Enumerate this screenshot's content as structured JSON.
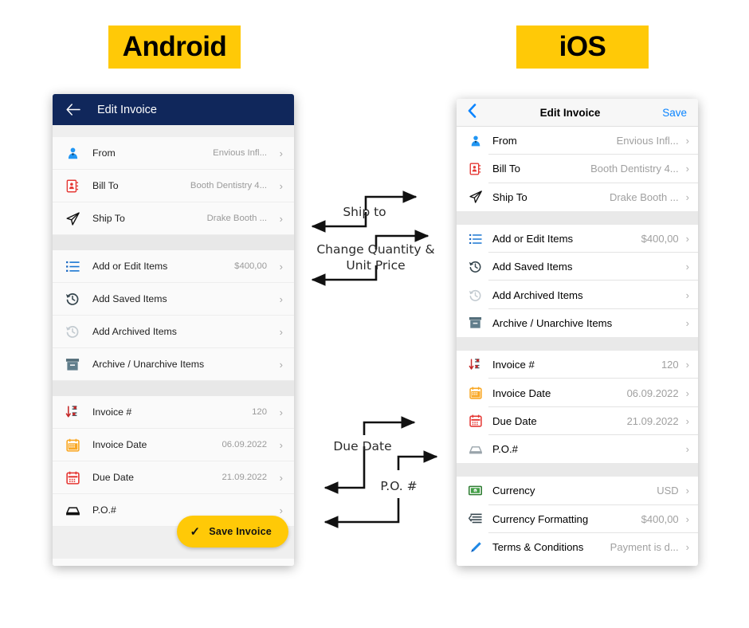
{
  "badges": {
    "android": "Android",
    "ios": "iOS"
  },
  "colors": {
    "brand_yellow": "#FFC907",
    "android_header_navy": "#10275B",
    "ios_accent_blue": "#0A84FF",
    "value_gray": "#9A9A9A"
  },
  "android": {
    "header": {
      "back_icon": "arrow-left-icon",
      "title": "Edit Invoice"
    },
    "sections": [
      {
        "rows": [
          {
            "icon": "person-blue-icon",
            "label": "From",
            "value": "Envious Infl...",
            "chevron": "›"
          },
          {
            "icon": "contact-card-icon",
            "label": "Bill To",
            "value": "Booth Dentistry 4...",
            "chevron": "›"
          },
          {
            "icon": "paper-plane-icon",
            "label": "Ship To",
            "value": "Drake Booth ...",
            "chevron": "›"
          }
        ]
      },
      {
        "rows": [
          {
            "icon": "list-icon",
            "label": "Add or Edit Items",
            "value": "$400,00",
            "chevron": "›"
          },
          {
            "icon": "history-icon",
            "label": "Add Saved Items",
            "value": "",
            "chevron": "›"
          },
          {
            "icon": "history-dim-icon",
            "label": "Add Archived Items",
            "value": "",
            "chevron": "›"
          },
          {
            "icon": "archive-box-icon",
            "label": "Archive / Unarchive Items",
            "value": "",
            "chevron": "›"
          }
        ]
      },
      {
        "rows": [
          {
            "icon": "sort-numeric-icon",
            "label": "Invoice #",
            "value": "120",
            "chevron": "›"
          },
          {
            "icon": "calendar-orange-icon",
            "label": "Invoice Date",
            "value": "06.09.2022",
            "chevron": "›"
          },
          {
            "icon": "calendar-red-icon",
            "label": "Due Date",
            "value": "21.09.2022",
            "chevron": "›"
          },
          {
            "icon": "inbox-icon",
            "label": "P.O.#",
            "value": "",
            "chevron": "›"
          }
        ]
      }
    ],
    "save_button": {
      "icon": "check-icon",
      "label": "Save Invoice"
    }
  },
  "ios": {
    "header": {
      "back_icon": "chevron-left-icon",
      "title": "Edit Invoice",
      "save_label": "Save"
    },
    "sections": [
      {
        "rows": [
          {
            "icon": "person-blue-icon",
            "label": "From",
            "value": "Envious Infl...",
            "chevron": "›"
          },
          {
            "icon": "contact-card-icon",
            "label": "Bill To",
            "value": "Booth Dentistry 4...",
            "chevron": "›"
          },
          {
            "icon": "paper-plane-icon",
            "label": "Ship To",
            "value": "Drake Booth ...",
            "chevron": "›"
          }
        ]
      },
      {
        "rows": [
          {
            "icon": "list-icon",
            "label": "Add or Edit Items",
            "value": "$400,00",
            "chevron": "›"
          },
          {
            "icon": "history-icon",
            "label": "Add Saved Items",
            "value": "",
            "chevron": "›"
          },
          {
            "icon": "history-dim-icon",
            "label": "Add Archived Items",
            "value": "",
            "chevron": "›"
          },
          {
            "icon": "archive-box-icon",
            "label": "Archive / Unarchive Items",
            "value": "",
            "chevron": "›"
          }
        ]
      },
      {
        "rows": [
          {
            "icon": "sort-numeric-icon",
            "label": "Invoice #",
            "value": "120",
            "chevron": "›"
          },
          {
            "icon": "calendar-orange-icon",
            "label": "Invoice Date",
            "value": "06.09.2022",
            "chevron": "›"
          },
          {
            "icon": "calendar-red-icon",
            "label": "Due Date",
            "value": "21.09.2022",
            "chevron": "›"
          },
          {
            "icon": "inbox-icon",
            "label": "P.O.#",
            "value": "",
            "chevron": "›"
          }
        ]
      },
      {
        "rows": [
          {
            "icon": "banknote-icon",
            "label": "Currency",
            "value": "USD",
            "chevron": "›"
          },
          {
            "icon": "text-format-icon",
            "label": "Currency Formatting",
            "value": "$400,00",
            "chevron": "›"
          },
          {
            "icon": "pencil-icon",
            "label": "Terms & Conditions",
            "value": "Payment is d...",
            "chevron": "›"
          }
        ]
      }
    ]
  },
  "annotations": [
    {
      "text": "Ship to"
    },
    {
      "text": "Change Quantity & Unit Price",
      "line1": "Change Quantity &",
      "line2": "Unit Price"
    },
    {
      "text": "Due Date"
    },
    {
      "text": "P.O. #"
    }
  ]
}
